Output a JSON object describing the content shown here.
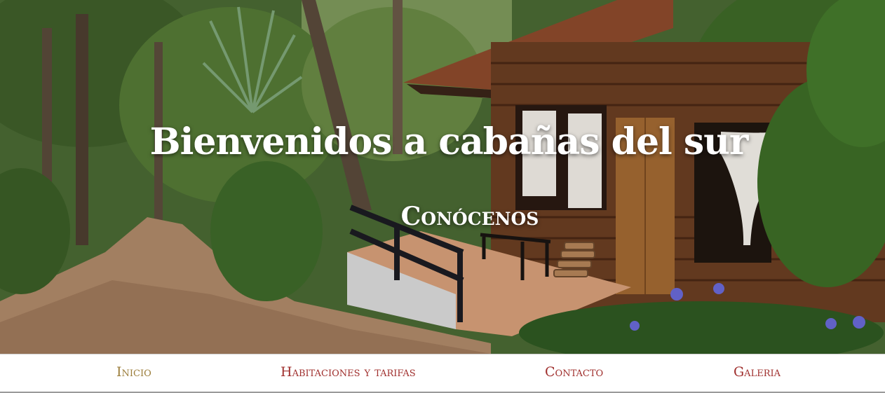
{
  "hero": {
    "title": "Bienvenidos a cabañas del sur",
    "subtitle": "Conócenos"
  },
  "nav": {
    "items": [
      {
        "label": "Inicio",
        "active": true
      },
      {
        "label": "Habitaciones y tarifas",
        "active": false
      },
      {
        "label": "Contacto",
        "active": false
      },
      {
        "label": "Galeria",
        "active": false
      }
    ]
  },
  "colors": {
    "nav_text": "#a0302e",
    "nav_active": "#9b7d3a",
    "title_text": "#ffffff"
  }
}
